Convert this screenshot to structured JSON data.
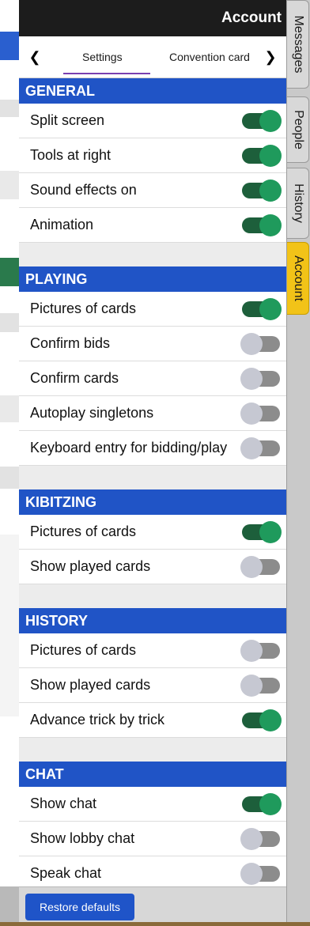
{
  "title": "Account",
  "nav": {
    "prev_icon": "chevron-left-icon",
    "next_icon": "chevron-right-icon",
    "tabs": [
      {
        "label": "Settings",
        "active": true
      },
      {
        "label": "Convention card",
        "active": false
      }
    ]
  },
  "side_tabs": [
    {
      "label": "Messages",
      "active": false
    },
    {
      "label": "People",
      "active": false
    },
    {
      "label": "History",
      "active": false
    },
    {
      "label": "Account",
      "active": true
    }
  ],
  "sections": [
    {
      "title": "GENERAL",
      "items": [
        {
          "label": "Split screen",
          "on": true
        },
        {
          "label": "Tools at right",
          "on": true
        },
        {
          "label": "Sound effects on",
          "on": true
        },
        {
          "label": "Animation",
          "on": true
        }
      ]
    },
    {
      "title": "PLAYING",
      "items": [
        {
          "label": "Pictures of cards",
          "on": true
        },
        {
          "label": "Confirm bids",
          "on": false
        },
        {
          "label": "Confirm cards",
          "on": false
        },
        {
          "label": "Autoplay singletons",
          "on": false
        },
        {
          "label": "Keyboard entry for bidding/play",
          "on": false
        }
      ]
    },
    {
      "title": "KIBITZING",
      "items": [
        {
          "label": "Pictures of cards",
          "on": true
        },
        {
          "label": "Show played cards",
          "on": false
        }
      ]
    },
    {
      "title": "HISTORY",
      "items": [
        {
          "label": "Pictures of cards",
          "on": false
        },
        {
          "label": "Show played cards",
          "on": false
        },
        {
          "label": "Advance trick by trick",
          "on": true
        }
      ]
    },
    {
      "title": "CHAT",
      "items": [
        {
          "label": "Show chat",
          "on": true
        },
        {
          "label": "Show lobby chat",
          "on": false
        },
        {
          "label": "Speak chat",
          "on": false
        }
      ]
    }
  ],
  "footer": {
    "restore_label": "Restore defaults"
  },
  "colors": {
    "section_header": "#2054c6",
    "toggle_on_track": "#1d5f3b",
    "toggle_on_knob": "#1f9a5c",
    "toggle_off_track": "#8c8c8c",
    "toggle_off_knob": "#c6c8d2",
    "active_tab": "#f2c318",
    "button": "#1f54c8"
  }
}
